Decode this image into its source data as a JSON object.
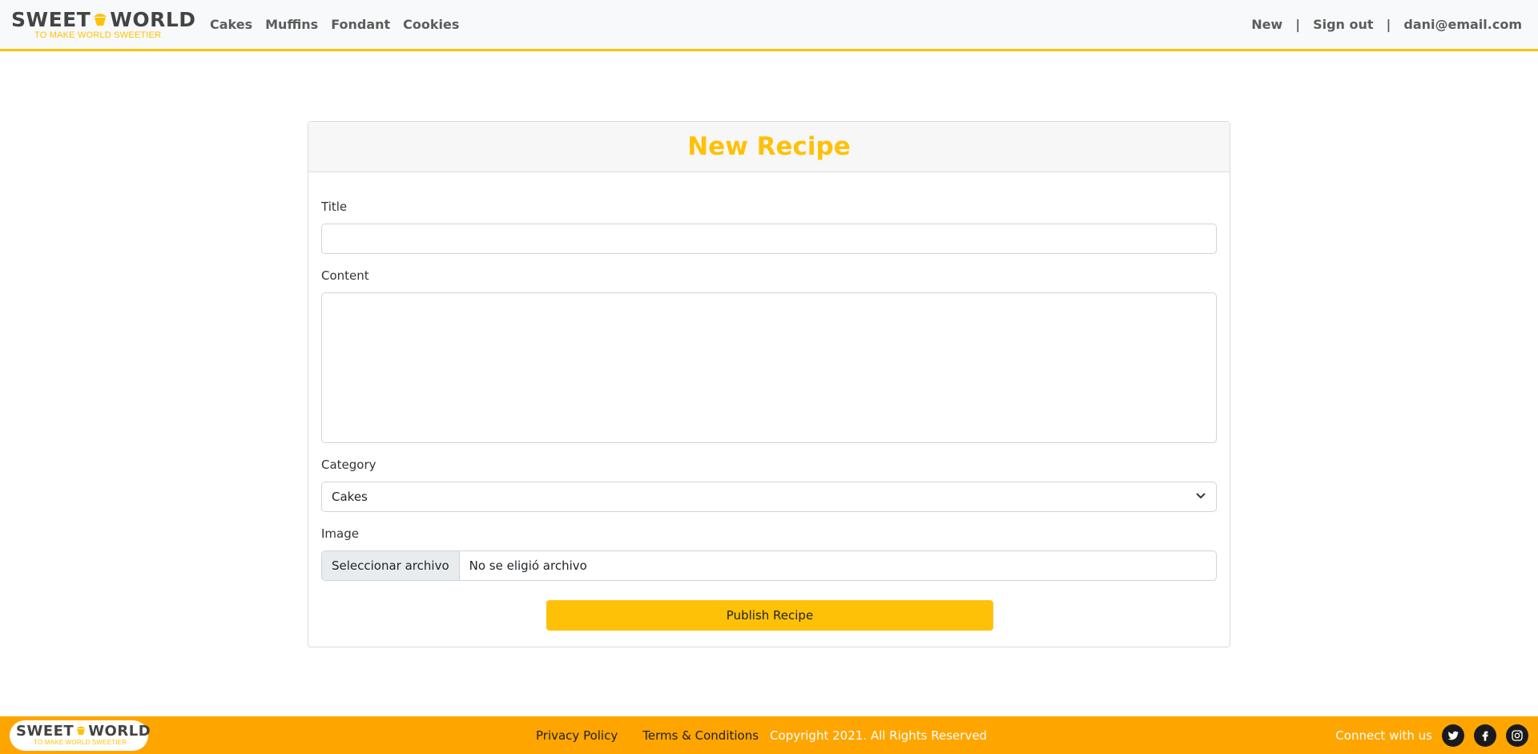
{
  "brand": {
    "name_left": "SWEET",
    "name_right": "WORLD",
    "tagline": "TO MAKE WORLD SWEETIER",
    "accent": "#ffc107",
    "footer_bg": "#ffa500"
  },
  "nav": {
    "links": [
      "Cakes",
      "Muffins",
      "Fondant",
      "Cookies"
    ],
    "new_label": "New",
    "separator": "|",
    "signout_label": "Sign out",
    "user_email": "dani@email.com"
  },
  "form": {
    "title": "New Recipe",
    "title_label": "Title",
    "title_value": "",
    "content_label": "Content",
    "content_value": "",
    "category_label": "Category",
    "category_value": "Cakes",
    "image_label": "Image",
    "file_button": "Seleccionar archivo",
    "file_status": "No se eligió archivo",
    "submit_label": "Publish Recipe"
  },
  "footer": {
    "privacy": "Privacy Policy",
    "terms": "Terms & Conditions",
    "copyright": "Copyright 2021. All Rights Reserved",
    "connect": "Connect with us",
    "social_icons": [
      "twitter-icon",
      "facebook-icon",
      "instagram-icon"
    ]
  }
}
